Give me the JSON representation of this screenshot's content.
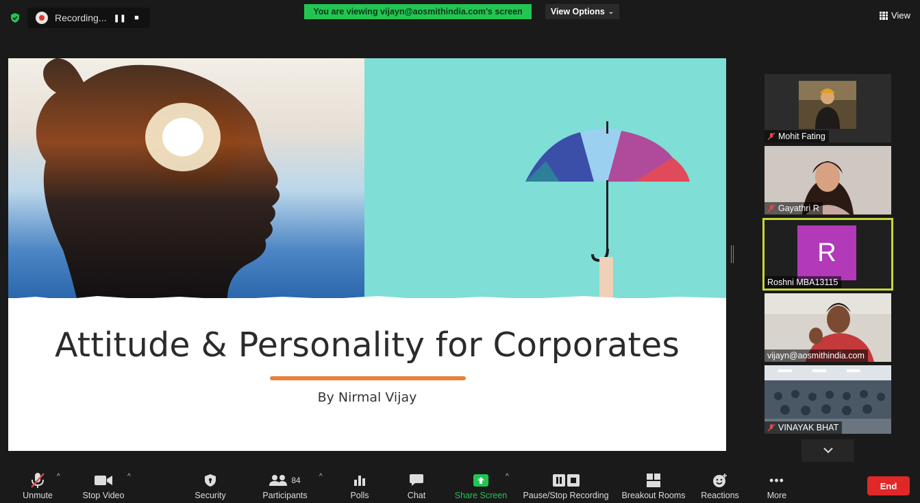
{
  "top": {
    "recording_label": "Recording...",
    "viewing_banner": "You are viewing vijayn@aosmithindia.com's screen",
    "view_options": "View Options",
    "view_label": "View"
  },
  "slide": {
    "title": "Attitude & Personality for Corporates",
    "subtitle": "By Nirmal Vijay"
  },
  "participants": [
    {
      "name": "Mohit Fating",
      "muted": true
    },
    {
      "name": "Gayathri R",
      "muted": true
    },
    {
      "name": "Roshni MBA13115",
      "muted": false,
      "avatar_letter": "R",
      "avatar_color": "#b23ab8"
    },
    {
      "name": "vijayn@aosmithindia.com",
      "muted": false
    },
    {
      "name": "VINAYAK BHAT",
      "muted": true
    }
  ],
  "toolbar": {
    "unmute": "Unmute",
    "stop_video": "Stop Video",
    "security": "Security",
    "participants": "Participants",
    "participants_count": "84",
    "polls": "Polls",
    "chat": "Chat",
    "share_screen": "Share Screen",
    "pause_stop_recording": "Pause/Stop Recording",
    "breakout_rooms": "Breakout Rooms",
    "reactions": "Reactions",
    "more": "More",
    "end": "End"
  },
  "colors": {
    "share_green": "#23c552",
    "end_red": "#e02828",
    "active_speaker": "#c7d83a",
    "accent_orange": "#e8823a"
  }
}
